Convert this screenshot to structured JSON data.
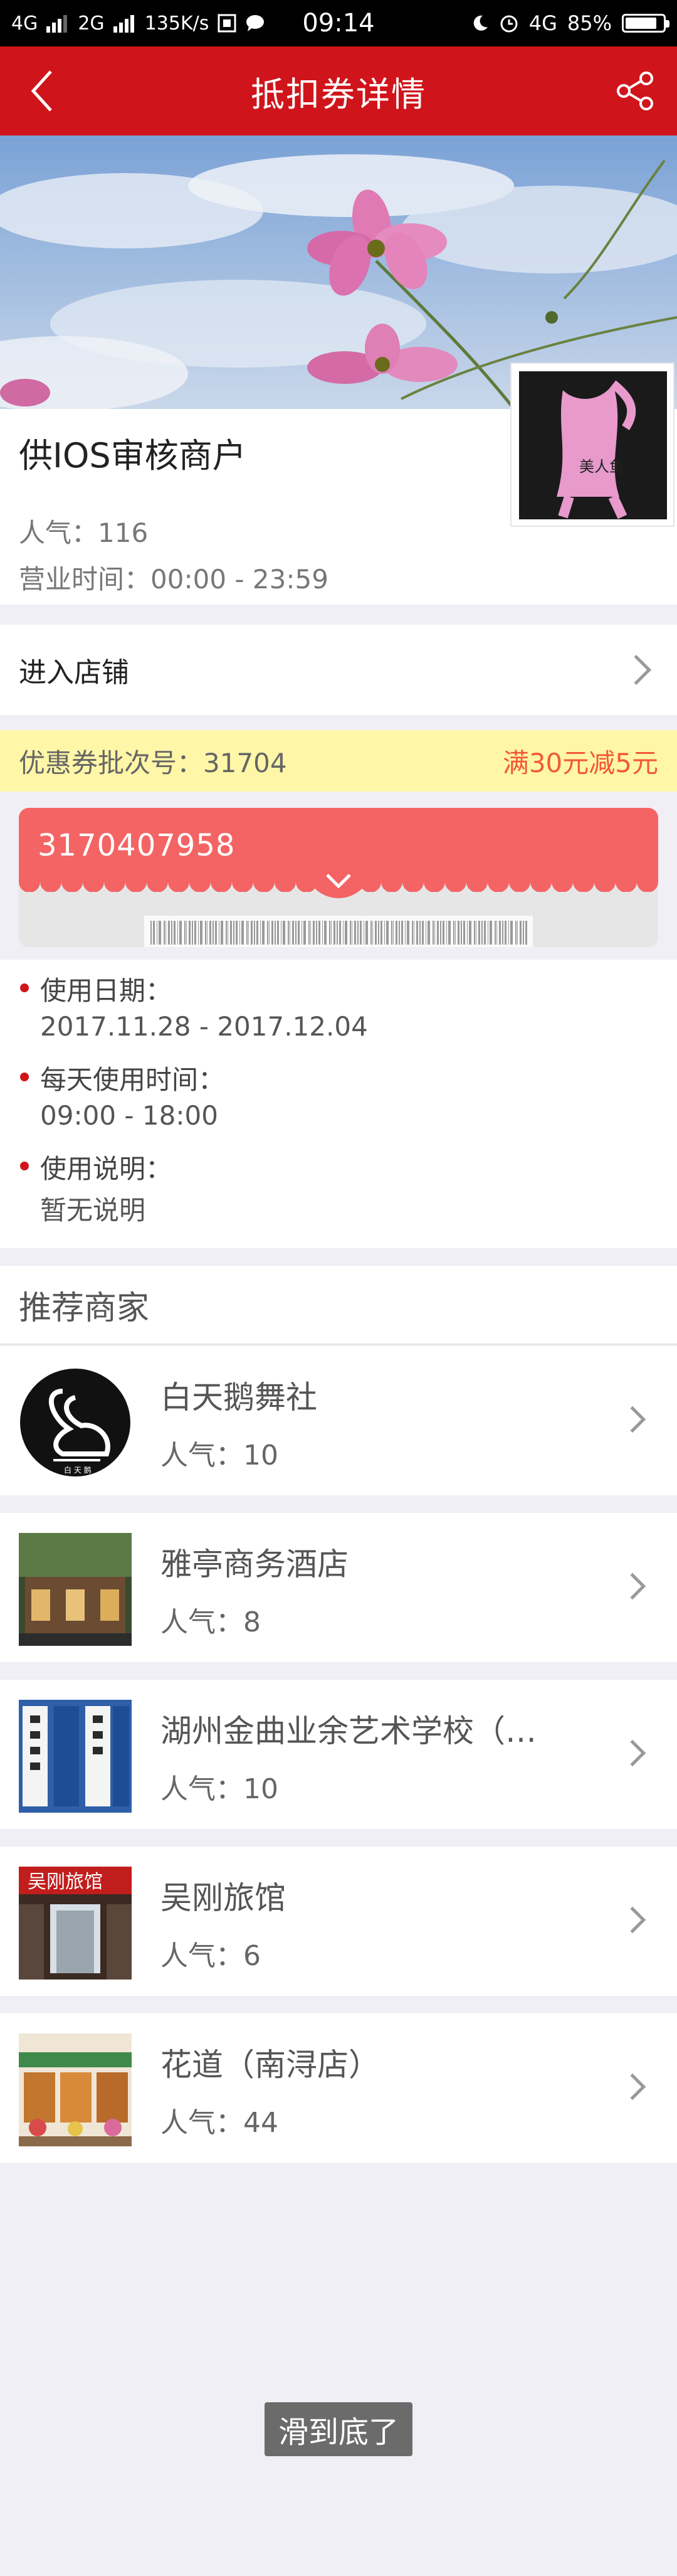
{
  "status_bar": {
    "network_1": "4G",
    "network_2": "2G",
    "speed": "135K/s",
    "time": "09:14",
    "network_3": "4G",
    "battery": "85%",
    "battery_level": 0.85
  },
  "header": {
    "title": "抵扣券详情",
    "back_icon": "chevron-left-icon",
    "share_icon": "share-icon"
  },
  "shop": {
    "name": "供IOS审核商户",
    "popularity": "人气：116",
    "hours": "营业时间：00:00 - 23:59",
    "thumb_caption": "美人鱼"
  },
  "enter_store": {
    "label": "进入店铺"
  },
  "coupon": {
    "batch_label": "优惠券批次号：31704",
    "rule": "满30元减5元",
    "code": "3170407958"
  },
  "usage": {
    "date_title": "使用日期：",
    "date_value": "2017.11.28 - 2017.12.04",
    "time_title": "每天使用时间：",
    "time_value": "09:00 - 18:00",
    "desc_title": "使用说明：",
    "desc_value": "暂无说明"
  },
  "recommended": {
    "title": "推荐商家",
    "items": [
      {
        "name": "白天鹅舞社",
        "popularity": "人气：10",
        "thumb_text": "白 天 鹅"
      },
      {
        "name": "雅亭商务酒店",
        "popularity": "人气：8"
      },
      {
        "name": "湖州金曲业余艺术学校（…",
        "popularity": "人气：10"
      },
      {
        "name": "吴刚旅馆",
        "popularity": "人气：6",
        "thumb_text": "吴刚旅馆"
      },
      {
        "name": "花道（南浔店）",
        "popularity": "人气：44"
      }
    ]
  },
  "footer": {
    "end_tip": "滑到底了"
  },
  "colors": {
    "primary_red": "#d0141b",
    "coupon_red": "#f46464",
    "batch_bg": "#fff6a8",
    "rule_orange": "#f25a35"
  }
}
